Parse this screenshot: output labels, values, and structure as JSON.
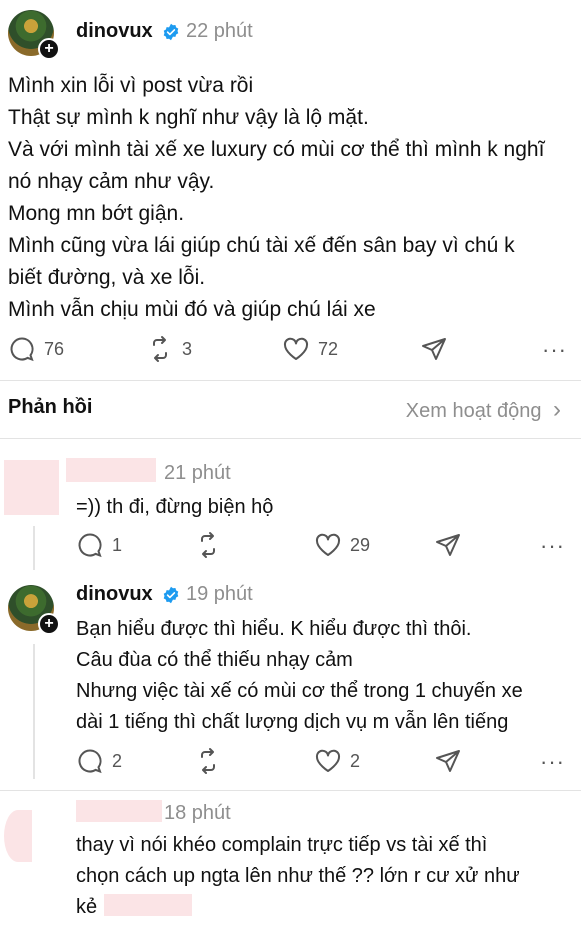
{
  "post": {
    "username": "dinovux",
    "time": "22 phút",
    "lines": [
      "Mình xin lỗi vì post vừa rồi",
      "Thật sự mình k nghĩ như vậy là lộ mặt.",
      "Và với mình tài xế xe luxury có mùi cơ thể thì mình k nghĩ",
      "nó nhạy cảm như vậy.",
      "Mong mn bớt giận.",
      "Mình cũng vừa lái giúp chú tài xế đến sân bay vì chú k",
      "biết đường, và xe lỗi.",
      "Mình vẫn chịu mùi đó và giúp chú lái xe"
    ],
    "comments": "76",
    "reposts": "3",
    "likes": "72",
    "more": "···"
  },
  "replies_header": {
    "title": "Phản hồi",
    "activity_link": "Xem hoạt động",
    "chevron": "›"
  },
  "replies": [
    {
      "username": "",
      "time": "21 phút",
      "lines": [
        "=)) th đi, đừng biện hộ"
      ],
      "comments": "1",
      "reposts": "",
      "likes": "29",
      "more": "···"
    },
    {
      "username": "dinovux",
      "time": "19 phút",
      "lines": [
        "Bạn hiểu được thì hiểu. K hiểu được thì thôi.",
        "Câu đùa có thể thiếu nhạy cảm",
        "Nhưng việc tài xế có mùi cơ thể trong 1 chuyến xe",
        "dài 1 tiếng thì chất lượng dịch vụ m vẫn lên tiếng"
      ],
      "comments": "2",
      "reposts": "",
      "likes": "2",
      "more": "···"
    },
    {
      "username": "",
      "time": "18 phút",
      "lines": [
        "thay vì nói khéo complain trực tiếp vs tài xế thì",
        "chọn cách up ngta lên như thế ?? lớn r cư xử như",
        "kẻ"
      ]
    }
  ],
  "colors": {
    "verified": "#1d9bf0",
    "redaction": "#fbe4e6",
    "muted": "#8e8e8e"
  },
  "icons": [
    "comment-icon",
    "repost-icon",
    "heart-icon",
    "share-icon",
    "verified-icon",
    "plus-icon"
  ]
}
